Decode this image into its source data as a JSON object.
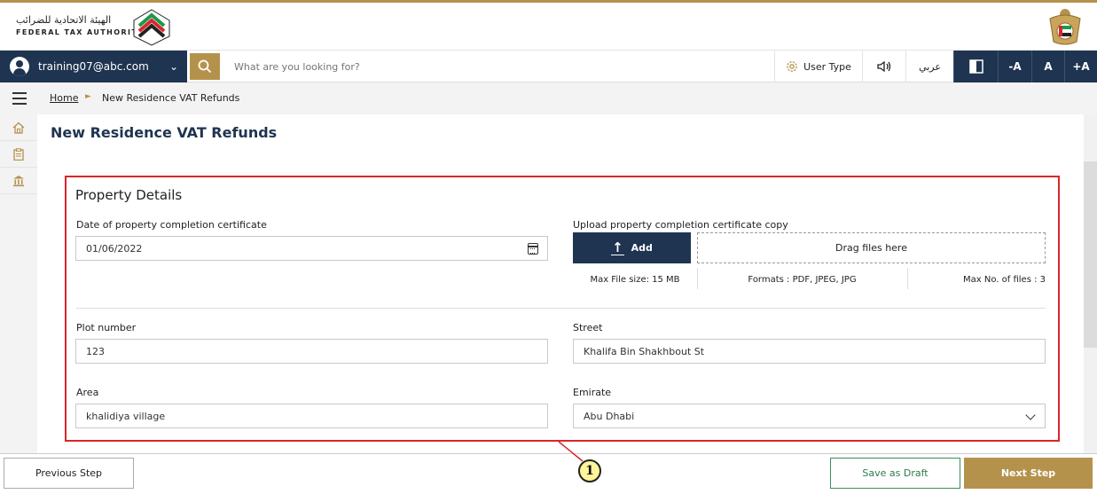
{
  "header": {
    "logo_ar": "الهيئة الاتحادية للضرائب",
    "logo_en": "FEDERAL TAX AUTHORITY",
    "logo_icon": "fta-logo-mark",
    "emblem_icon": "uae-emblem"
  },
  "nav": {
    "user_email": "training07@abc.com",
    "search_placeholder": "What are you looking for?",
    "user_type_label": "User Type",
    "arabic_label": "عربي",
    "font_decrease": "-A",
    "font_normal": "A",
    "font_increase": "+A"
  },
  "breadcrumb": {
    "home": "Home",
    "separator": "►",
    "current": "New Residence VAT Refunds"
  },
  "page": {
    "title": "New Residence VAT Refunds"
  },
  "property": {
    "section_title": "Property Details",
    "date_label": "Date of property completion certificate",
    "date_value": "01/06/2022",
    "upload_label": "Upload property completion certificate copy",
    "add_label": "Add",
    "drag_label": "Drag files here",
    "max_size": "Max File size: 15 MB",
    "formats": "Formats : PDF, JPEG, JPG",
    "max_files": "Max No. of files : 3",
    "plot_label": "Plot number",
    "plot_value": "123",
    "street_label": "Street",
    "street_value": "Khalifa Bin Shakhbout St",
    "area_label": "Area",
    "area_value": "khalidiya village",
    "emirate_label": "Emirate",
    "emirate_value": "Abu Dhabi"
  },
  "footer": {
    "prev": "Previous Step",
    "draft": "Save as Draft",
    "next": "Next Step"
  },
  "callout": {
    "number": "1"
  },
  "colors": {
    "navy": "#1f3450",
    "gold": "#b5924c",
    "highlight_red": "#d9262c",
    "draft_green": "#2f7a4a"
  }
}
